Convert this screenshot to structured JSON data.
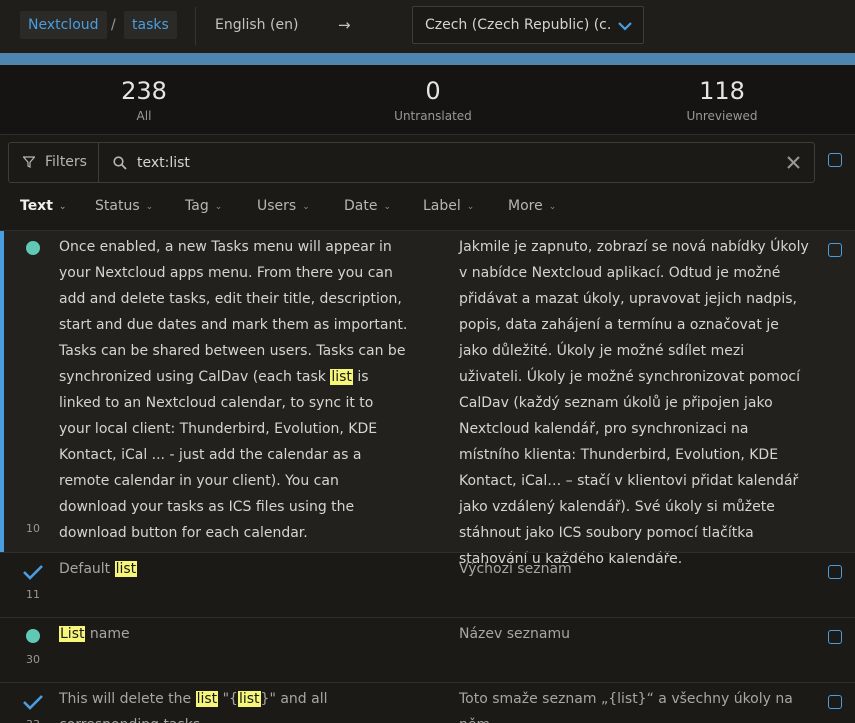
{
  "header": {
    "project": "Nextcloud",
    "component": "tasks",
    "breadcrumb_sep": "/",
    "source_language": "English (en)",
    "arrow": "→",
    "target_language": "Czech (Czech Republic) (c..."
  },
  "stats": [
    {
      "count": "238",
      "label": "All"
    },
    {
      "count": "0",
      "label": "Untranslated"
    },
    {
      "count": "118",
      "label": "Unreviewed"
    }
  ],
  "search": {
    "filters_label": "Filters",
    "query": "text:list"
  },
  "tabs": [
    "Text",
    "Status",
    "Tag",
    "Users",
    "Date",
    "Label",
    "More"
  ],
  "rows": [
    {
      "id": "10",
      "state": "dot",
      "source_pre": "Once enabled, a new Tasks menu will appear in your Nextcloud apps menu. From there you can add and delete tasks, edit their title, description, start and due dates and mark them as important. Tasks can be shared between users. Tasks can be synchronized using CalDav (each task ",
      "source_hl": "list",
      "source_post": " is linked to an Nextcloud calendar, to sync it to your local client: Thunderbird, Evolution, KDE Kontact, iCal ... - just add the calendar as a remote calendar in your client). You can download your tasks as ICS files using the download button for each calendar.",
      "target": "Jakmile je zapnuto, zobrazí se nová nabídky Úkoly v nabídce Nextcloud aplikací. Odtud je možné přidávat a mazat úkoly, upravovat jejich nadpis, popis, data zahájení a termínu a označovat  je jako důležité. Úkoly je možné sdílet mezi uživateli. Úkoly je možné synchronizovat pomocí CalDav (každý seznam úkolů je připojen jako Nextcloud kalendář, pro synchronizaci na místního klienta: Thunderbird, Evolution, KDE Kontact, iCal… – stačí v klientovi přidat kalendář jako vzdálený kalendář). Své úkoly si můžete stáhnout jako ICS soubory pomocí tlačítka stahování u každého kalendáře."
    },
    {
      "id": "11",
      "state": "check",
      "source_pre": "Default ",
      "source_hl": "list",
      "source_post": "",
      "target": "Výchozí seznam"
    },
    {
      "id": "30",
      "state": "dot",
      "source_pre": "",
      "source_hl": "List",
      "source_post": " name",
      "target": "Název seznamu"
    },
    {
      "id": "33",
      "state": "check",
      "source_pre": "This will delete the ",
      "source_hl": "list",
      "source_mid": " \"{",
      "source_hl2": "list",
      "source_post": "}\" and all corresponding tasks.",
      "target": "Toto smaže seznam „{list}“ a všechny úkoly na něm."
    }
  ],
  "colors": {
    "accent": "#4a9ee0",
    "progress": "#4f86b0",
    "translated_dot": "#5fc9b5",
    "highlight": "#f6f67a"
  }
}
